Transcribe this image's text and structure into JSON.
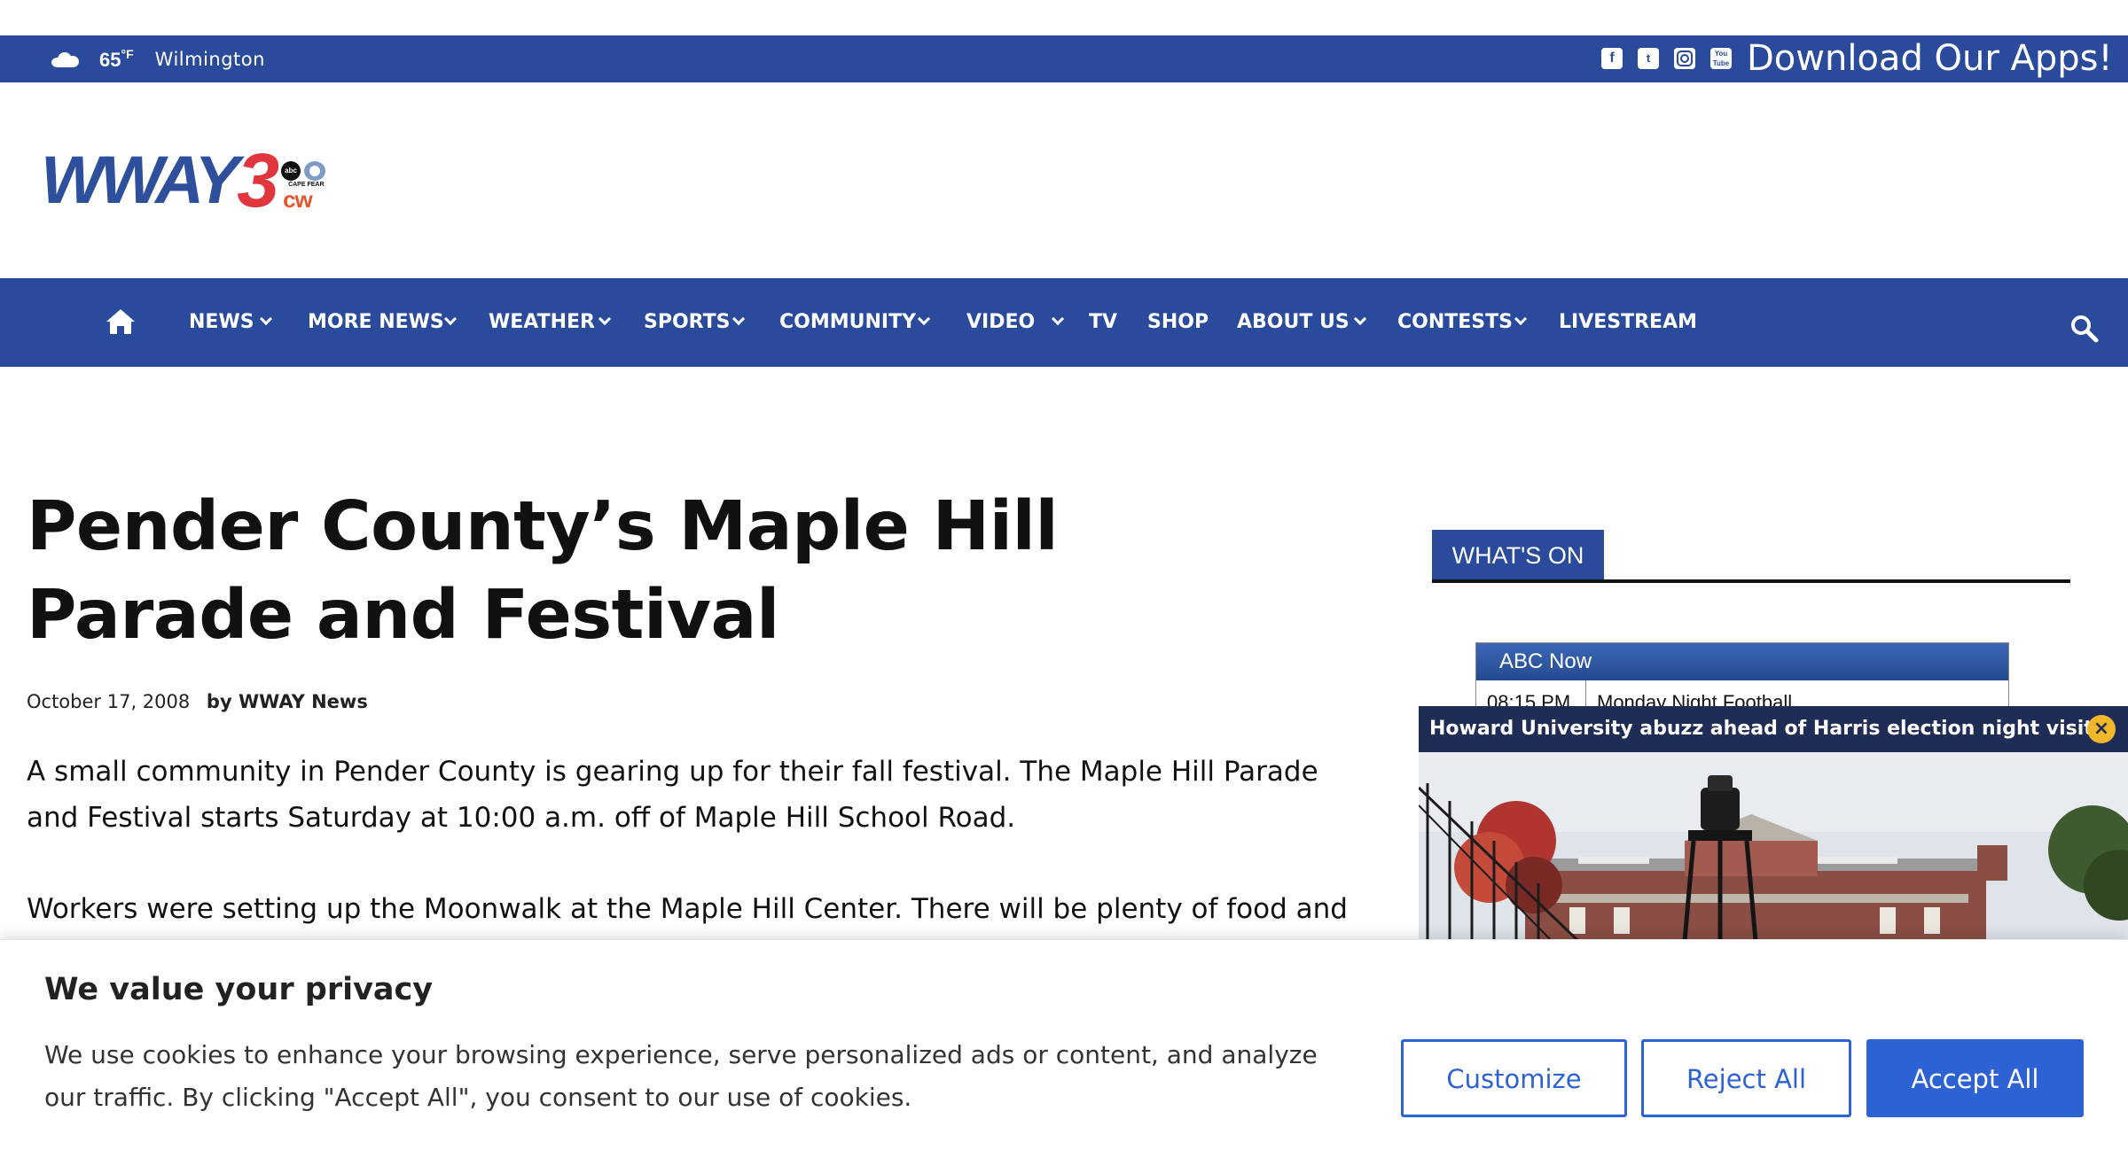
{
  "topbar": {
    "weather_icon": "cloud-icon",
    "temperature": "65",
    "temperature_unit": "°F",
    "city": "Wilmington",
    "social_icons": [
      "facebook-icon",
      "twitter-icon",
      "instagram-icon",
      "youtube-icon"
    ],
    "apps_label": "Download Our Apps!"
  },
  "logo": {
    "wordmark": "WWAY",
    "channel_number": "3",
    "badge_abc": "abc",
    "badge_capefear": "CAPE FEAR",
    "badge_cw": "cw"
  },
  "nav": {
    "home_icon": "home-icon",
    "items": [
      {
        "label": "NEWS",
        "has_dropdown": true
      },
      {
        "label": "MORE NEWS",
        "has_dropdown": true
      },
      {
        "label": "WEATHER",
        "has_dropdown": true
      },
      {
        "label": "SPORTS",
        "has_dropdown": true
      },
      {
        "label": "COMMUNITY",
        "has_dropdown": true
      },
      {
        "label": "VIDEO",
        "has_dropdown": true
      },
      {
        "label": "TV",
        "has_dropdown": false
      },
      {
        "label": "SHOP",
        "has_dropdown": false
      },
      {
        "label": "ABOUT US",
        "has_dropdown": true
      },
      {
        "label": "CONTESTS",
        "has_dropdown": true
      },
      {
        "label": "LIVESTREAM",
        "has_dropdown": false
      }
    ],
    "search_icon": "search-icon"
  },
  "article": {
    "title": "Pender County’s Maple Hill Parade and Festival",
    "date": "October 17, 2008",
    "byline": "by WWAY News",
    "paragraphs": [
      "A small community in Pender County is gearing up for their fall festival. The Maple Hill Parade and Festival starts Saturday at 10:00 a.m. off of Maple Hill School Road.",
      "Workers were setting up the Moonwalk at the Maple Hill Center. There will be plenty of food and"
    ]
  },
  "sidebar": {
    "section_title": "WHAT'S ON",
    "schedule": {
      "network": "ABC Now",
      "rows": [
        {
          "time": "08:15 PM",
          "show": "Monday Night Football"
        }
      ]
    }
  },
  "video_popup": {
    "headline": "Howard University abuzz ahead of Harris election night visit",
    "close_icon": "close-icon"
  },
  "cookie_banner": {
    "title": "We value your privacy",
    "text": "We use cookies to enhance your browsing experience, serve personalized ads or content, and analyze our traffic. By clicking \"Accept All\", you consent to our use of cookies.",
    "buttons": {
      "customize": "Customize",
      "reject": "Reject All",
      "accept": "Accept All"
    }
  },
  "colors": {
    "brand_blue": "#2a4a9c",
    "video_bar": "#1f2d56",
    "cookie_button": "#2d62d4",
    "logo_red": "#e2363f"
  }
}
